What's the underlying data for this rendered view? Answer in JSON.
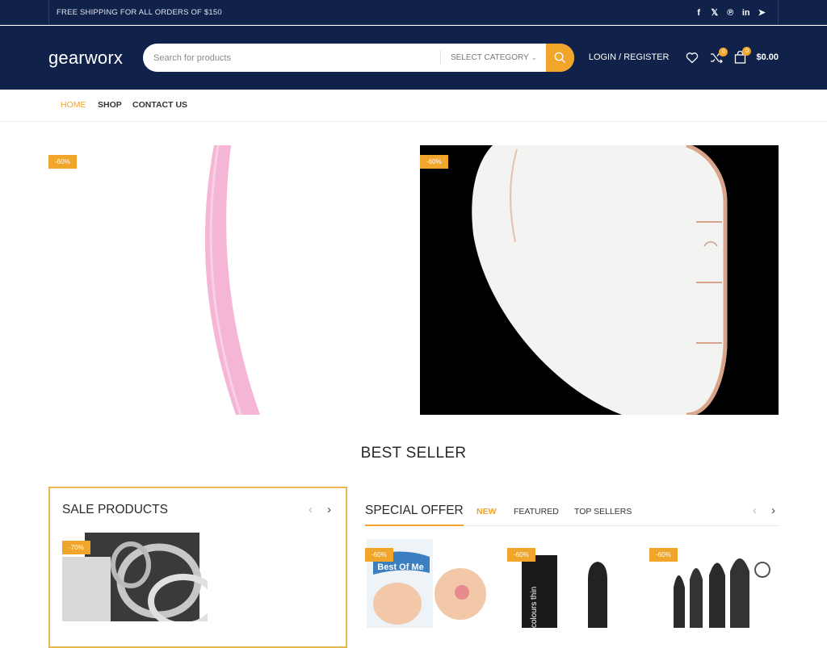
{
  "topbar": {
    "shipping_text": "FREE SHIPPING FOR ALL ORDERS OF $150",
    "socials": [
      "facebook-icon",
      "x-icon",
      "pinterest-icon",
      "linkedin-icon",
      "telegram-icon"
    ],
    "social_glyphs": [
      "f",
      "𝕏",
      "℗",
      "in",
      "➤"
    ]
  },
  "header": {
    "logo": "gearworx",
    "search_placeholder": "Search for products",
    "category_label": "SELECT CATEGORY",
    "login_label": "LOGIN / REGISTER",
    "compare_count": "0",
    "cart_count": "0",
    "cart_amount": "$0.00"
  },
  "nav": {
    "items": [
      {
        "label": "HOME",
        "active": true
      },
      {
        "label": "SHOP",
        "active": false
      },
      {
        "label": "CONTACT US",
        "active": false
      }
    ]
  },
  "banners": [
    {
      "badge": "-60%"
    },
    {
      "badge": "-60%"
    }
  ],
  "best_seller": {
    "title": "BEST SELLER"
  },
  "sale_products": {
    "title": "SALE PRODUCTS",
    "badge": "-70%"
  },
  "special_offer": {
    "title": "SPECIAL OFFER",
    "tabs": [
      "NEW",
      "FEATURED",
      "TOP SELLERS"
    ],
    "products": [
      {
        "badge": "-60%",
        "brand": "Best Of Me"
      },
      {
        "badge": "-60%",
        "brand": "colours thin"
      },
      {
        "badge": "-60%",
        "brand": ""
      }
    ]
  },
  "colors": {
    "accent": "#f1a52a",
    "header_bg": "#10224a"
  }
}
